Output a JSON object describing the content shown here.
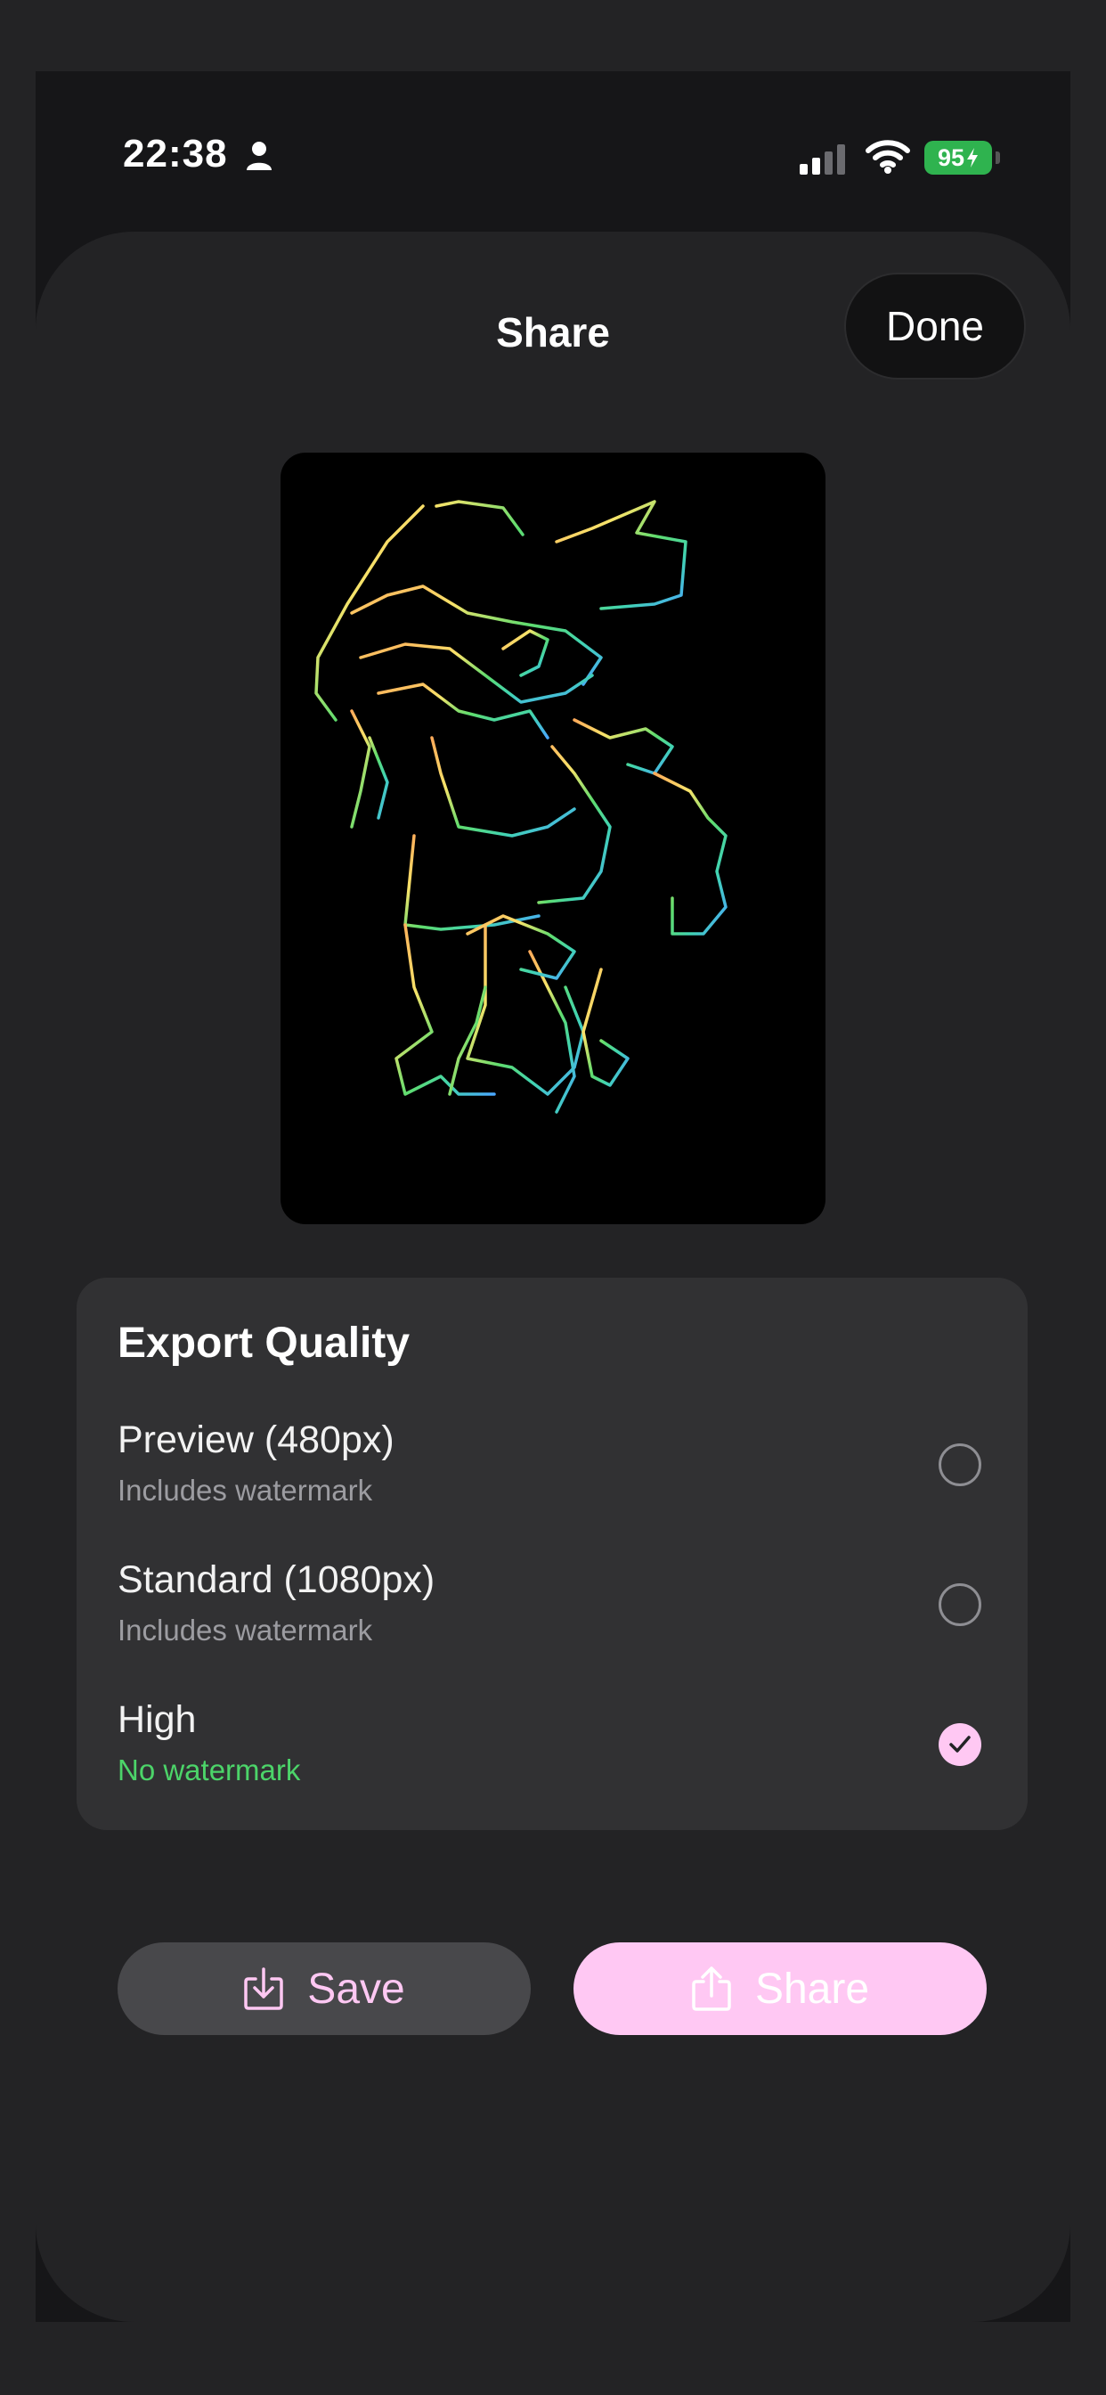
{
  "status_bar": {
    "time": "22:38",
    "battery": "95",
    "icons": [
      "person-icon",
      "signal-icon",
      "wifi-icon",
      "battery-charging-icon"
    ]
  },
  "header": {
    "title": "Share",
    "done_label": "Done"
  },
  "quality": {
    "title": "Export Quality",
    "options": [
      {
        "label": "Preview (480px)",
        "sub": "Includes watermark",
        "selected": false
      },
      {
        "label": "Standard (1080px)",
        "sub": "Includes watermark",
        "selected": false
      },
      {
        "label": "High",
        "sub": "No watermark",
        "selected": true
      }
    ]
  },
  "actions": {
    "save_label": "Save",
    "share_label": "Share"
  },
  "colors": {
    "accent_pink": "#ffc8f3",
    "success_green": "#4cd469",
    "battery_green": "#2fb34f",
    "sheet_background": "#232325"
  }
}
